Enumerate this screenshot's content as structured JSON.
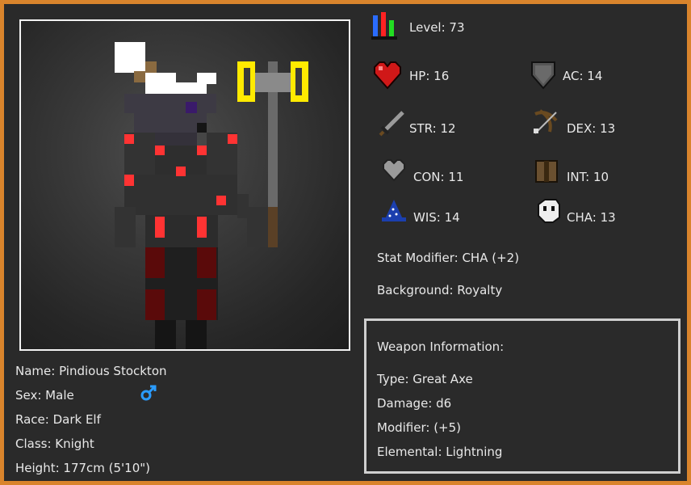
{
  "level": {
    "label": "Level: 73"
  },
  "stats": {
    "hp": "HP: 16",
    "ac": "AC: 14",
    "str": "STR: 12",
    "dex": "DEX: 13",
    "con": "CON: 11",
    "int": "INT: 10",
    "wis": "WIS: 14",
    "cha": "CHA: 13"
  },
  "stat_modifier": "Stat Modifier: CHA (+2)",
  "background": "Background: Royalty",
  "character": {
    "name": "Name: Pindious Stockton",
    "sex": "Sex: Male",
    "race": "Race: Dark Elf",
    "class": "Class: Knight",
    "height": "Height: 177cm (5'10\")"
  },
  "weapon": {
    "heading": "Weapon Information:",
    "type": "Type: Great Axe",
    "damage": "Damage: d6",
    "modifier": "Modifier: (+5)",
    "elemental": "Elemental: Lightning"
  },
  "icons": {
    "level": "level-bars-icon",
    "hp": "heart-icon",
    "ac": "shield-icon",
    "str": "sword-icon",
    "dex": "bow-icon",
    "con": "grey-heart-icon",
    "int": "book-icon",
    "wis": "wizard-hat-icon",
    "cha": "mask-icon",
    "sex": "male-symbol-icon"
  },
  "colors": {
    "frame": "#d9842c",
    "panel": "#2a2a2a",
    "text": "#e8e8e8",
    "accent_red": "#ff3333",
    "lightning_yellow": "#ffea00"
  }
}
